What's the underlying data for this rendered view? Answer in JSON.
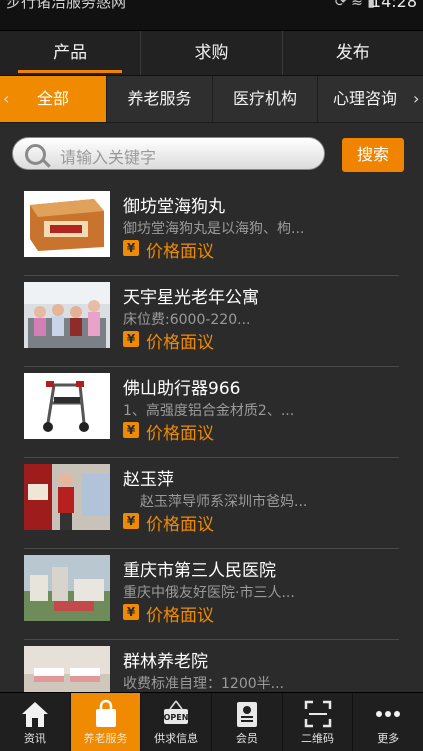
{
  "statusbar": {
    "truncated_text": "步行诸洁服务惑网",
    "time": "14:28"
  },
  "toptabs": [
    {
      "label": "产品",
      "active": true
    },
    {
      "label": "求购",
      "active": false
    },
    {
      "label": "发布",
      "active": false
    }
  ],
  "categories": [
    {
      "label": "全部",
      "active": true
    },
    {
      "label": "养老服务",
      "active": false
    },
    {
      "label": "医疗机构",
      "active": false
    },
    {
      "label": "心理咨询",
      "active": false
    }
  ],
  "search": {
    "placeholder": "请输入关键字",
    "button_label": "搜索"
  },
  "items": [
    {
      "title": "御坊堂海狗丸",
      "desc": "御坊堂海狗丸是以海狗、枸...",
      "price": "价格面议"
    },
    {
      "title": "天宇星光老年公寓",
      "desc": "床位费:6000-220...",
      "price": "价格面议"
    },
    {
      "title": "佛山助行器966",
      "desc": "1、高强度铝合金材质2、...",
      "price": "价格面议"
    },
    {
      "title": "赵玉萍",
      "desc": "赵玉萍导师系深圳市爸妈...",
      "price": "价格面议"
    },
    {
      "title": "重庆市第三人民医院",
      "desc": "重庆中俄友好医院·市三人...",
      "price": "价格面议"
    },
    {
      "title": "群林养老院",
      "desc": "收费标准自理：1200半...",
      "price": ""
    }
  ],
  "bottomnav": [
    {
      "label": "资讯",
      "icon": "home-icon",
      "active": false
    },
    {
      "label": "养老服务",
      "icon": "shopping-bag-icon",
      "active": true
    },
    {
      "label": "供求信息",
      "icon": "open-sign-icon",
      "active": false
    },
    {
      "label": "会员",
      "icon": "id-card-icon",
      "active": false
    },
    {
      "label": "二维码",
      "icon": "qr-scan-icon",
      "active": false
    },
    {
      "label": "更多",
      "icon": "more-dots-icon",
      "active": false
    }
  ],
  "colors": {
    "accent": "#f08a00",
    "background": "#2b2b2b",
    "text_secondary": "#9a9a9a"
  }
}
